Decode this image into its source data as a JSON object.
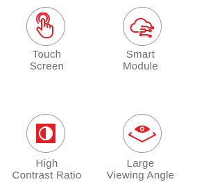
{
  "accent_color": "#e31e24",
  "features": [
    {
      "icon": "touch-hand-icon",
      "label_line1": "Touch",
      "label_line2": "Screen"
    },
    {
      "icon": "cloud-network-icon",
      "label_line1": "Smart",
      "label_line2": "Module"
    },
    {
      "icon": "contrast-icon",
      "label_line1": "High",
      "label_line2": "Contrast Ratio"
    },
    {
      "icon": "eye-viewing-angle-icon",
      "label_line1": "Large",
      "label_line2": "Viewing Angle"
    }
  ]
}
